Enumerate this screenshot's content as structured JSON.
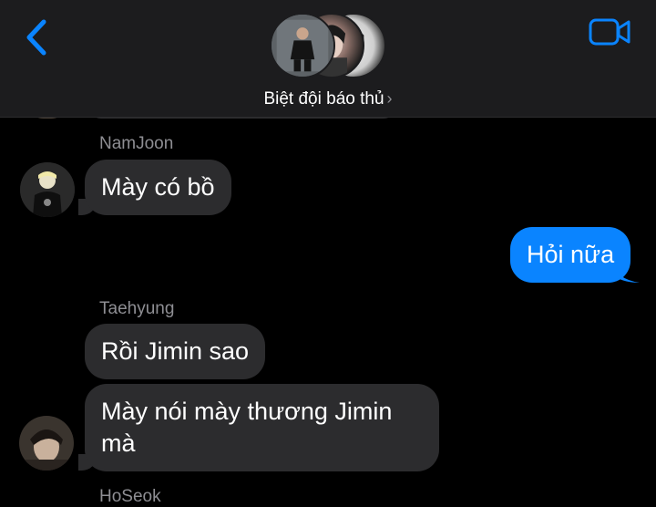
{
  "header": {
    "group_name": "Biệt đội báo thủ",
    "chevron": "›",
    "back_icon": "chevron-left-icon",
    "call_icon": "video-camera-icon",
    "accent": "#0a84ff"
  },
  "messages": [
    {
      "sender": "NamJoon",
      "text": "Mày có bồ",
      "direction": "incoming"
    },
    {
      "text": "Hỏi nữa",
      "direction": "outgoing"
    },
    {
      "sender": "Taehyung",
      "text": "Rồi Jimin sao",
      "direction": "incoming"
    },
    {
      "text": "Mày nói mày thương Jimin mà",
      "direction": "incoming"
    },
    {
      "sender": "HoSeok",
      "direction": "incoming"
    }
  ],
  "colors": {
    "incoming_bubble": "#2c2c2e",
    "outgoing_bubble": "#0a84ff",
    "sender_label": "#8e8e93",
    "background": "#000000"
  }
}
